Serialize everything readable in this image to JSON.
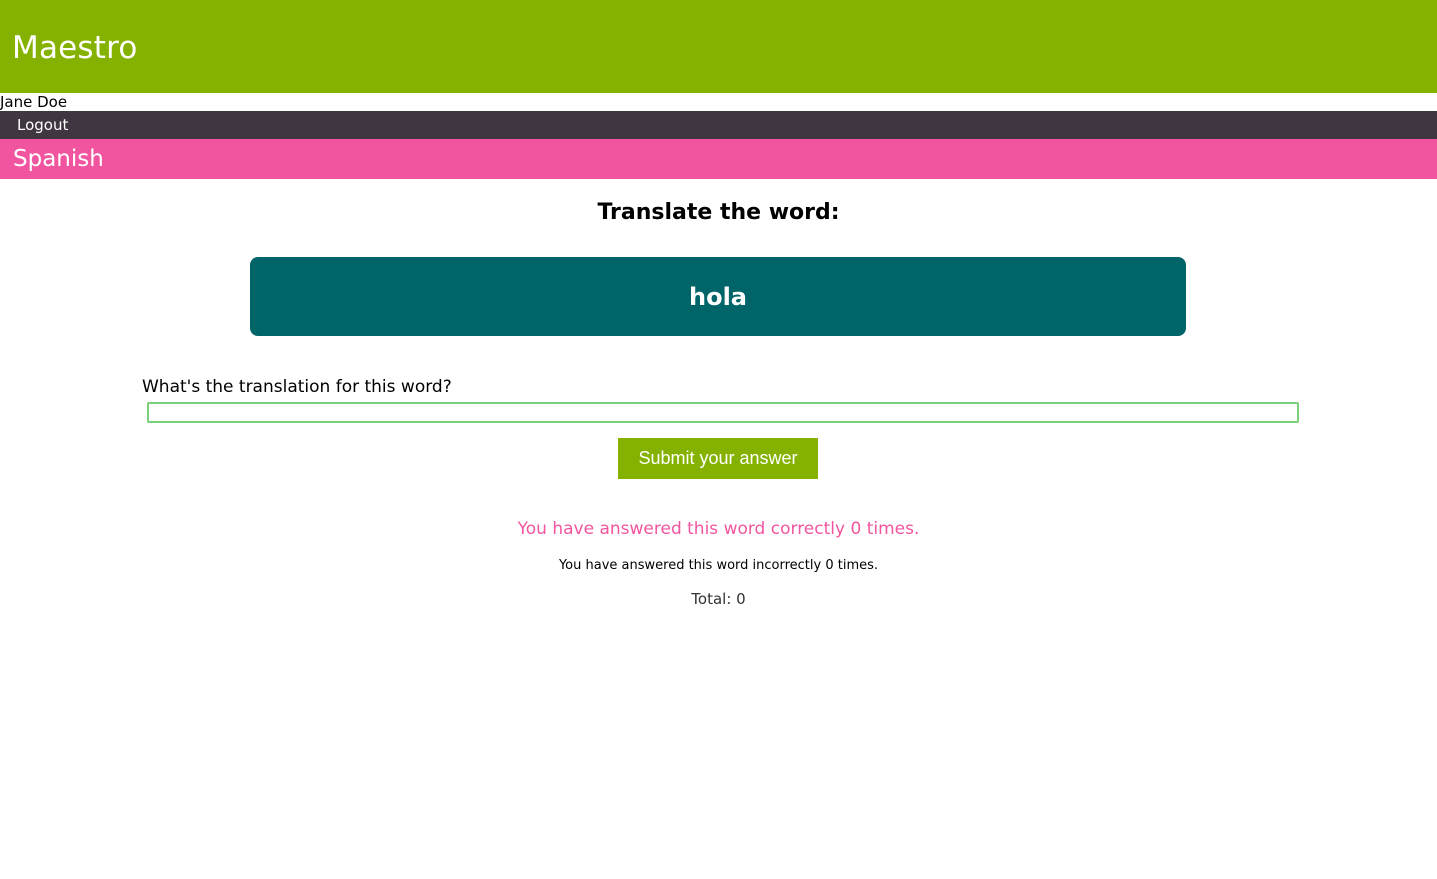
{
  "app": {
    "title": "Maestro"
  },
  "user": {
    "name": "Jane Doe"
  },
  "nav": {
    "logout_label": "Logout"
  },
  "language": {
    "name": "Spanish"
  },
  "quiz": {
    "heading": "Translate the word:",
    "word": "hola",
    "answer_label": "What's the translation for this word?",
    "answer_value": "",
    "submit_label": "Submit your answer"
  },
  "stats": {
    "correct_text": "You have answered this word correctly 0 times.",
    "incorrect_text": "You have answered this word incorrectly 0 times.",
    "total_text": "Total: 0"
  },
  "colors": {
    "header_green": "#85b200",
    "nav_dark": "#403641",
    "language_pink": "#f2559f",
    "card_teal": "#006569",
    "input_border": "#7bd17b"
  }
}
